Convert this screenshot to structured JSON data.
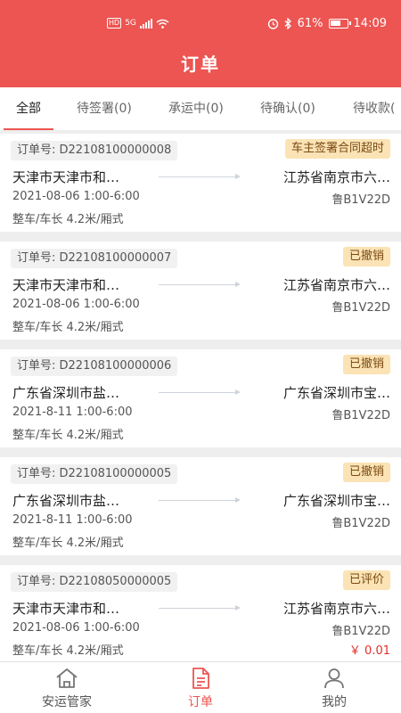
{
  "status_bar": {
    "left": "HD",
    "network": "5G",
    "battery": "61%",
    "time": "14:09"
  },
  "header": {
    "title": "订单"
  },
  "tabs": [
    {
      "label": "全部",
      "active": true
    },
    {
      "label": "待签署(0)"
    },
    {
      "label": "承运中(0)"
    },
    {
      "label": "待确认(0)"
    },
    {
      "label": "待收款("
    }
  ],
  "orders": [
    {
      "order_no": "订单号: D22108100000008",
      "status": "车主签署合同超时",
      "from": "天津市天津市和…",
      "to": "江苏省南京市六…",
      "time": "2021-08-06  1:00-6:00",
      "plate": "鲁B1V22D",
      "spec": "整车/车长 4.2米/厢式",
      "price": ""
    },
    {
      "order_no": "订单号: D22108100000007",
      "status": "已撤销",
      "from": "天津市天津市和…",
      "to": "江苏省南京市六…",
      "time": "2021-08-06  1:00-6:00",
      "plate": "鲁B1V22D",
      "spec": "整车/车长 4.2米/厢式",
      "price": ""
    },
    {
      "order_no": "订单号: D22108100000006",
      "status": "已撤销",
      "from": "广东省深圳市盐…",
      "to": "广东省深圳市宝…",
      "time": "2021-8-11  1:00-6:00",
      "plate": "鲁B1V22D",
      "spec": "整车/车长 4.2米/厢式",
      "price": ""
    },
    {
      "order_no": "订单号: D22108100000005",
      "status": "已撤销",
      "from": "广东省深圳市盐…",
      "to": "广东省深圳市宝…",
      "time": "2021-8-11  1:00-6:00",
      "plate": "鲁B1V22D",
      "spec": "整车/车长 4.2米/厢式",
      "price": ""
    },
    {
      "order_no": "订单号: D22108050000005",
      "status": "已评价",
      "from": "天津市天津市和…",
      "to": "江苏省南京市六…",
      "time": "2021-08-06  1:00-6:00",
      "plate": "鲁B1V22D",
      "spec": "整车/车长 4.2米/厢式",
      "price": "￥ 0.01"
    }
  ],
  "bottom_nav": [
    {
      "label": "安运管家",
      "icon": "home-icon"
    },
    {
      "label": "订单",
      "icon": "document-icon",
      "active": true
    },
    {
      "label": "我的",
      "icon": "user-icon"
    }
  ],
  "colors": {
    "brand": "#ec5552",
    "badge_bg": "#fbe3b5",
    "price": "#e0302a"
  }
}
